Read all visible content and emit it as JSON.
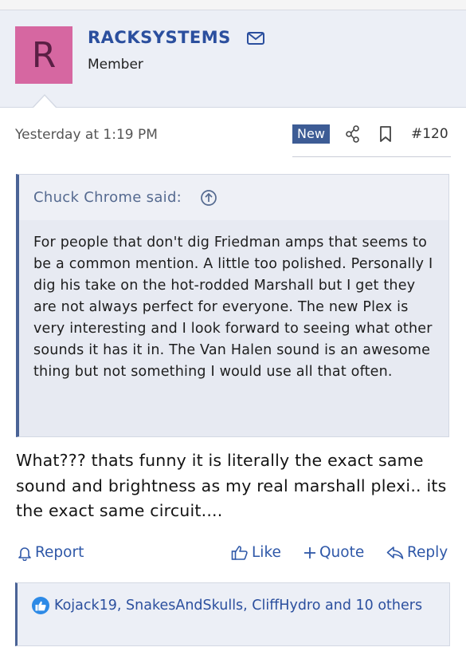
{
  "user": {
    "avatar_letter": "R",
    "avatar_color": "#d667a1",
    "name": "RACKSYSTEMS",
    "title": "Member"
  },
  "post": {
    "timestamp": "Yesterday at 1:19 PM",
    "badge": "New",
    "number": "#120",
    "quote": {
      "author_line": "Chuck Chrome said:",
      "text": "For people that don't dig Friedman amps that seems to be a common mention. A little too polished. Personally I dig his take on the hot-rodded Marshall but I get they are not always perfect for everyone. The new Plex is very interesting and I look forward to seeing what other sounds it has it in. The Van Halen sound is an awesome thing but not something I would use all that often."
    },
    "body": "What??? thats funny it is literally the exact same sound and brightness as my real marshall plexi.. its the exact same circuit...."
  },
  "actions": {
    "report": "Report",
    "like": "Like",
    "quote": "Quote",
    "reply": "Reply"
  },
  "reactions": {
    "text": "Kojack19, SnakesAndSkulls, CliffHydro and 10 others"
  },
  "icons": [
    "mail-icon",
    "share-icon",
    "bookmark-icon",
    "arrow-up-circle-icon",
    "bell-icon",
    "thumbs-up-icon",
    "plus-icon",
    "reply-arrow-icon",
    "like-reaction-icon"
  ],
  "colors": {
    "accent": "#2b4f9e",
    "link": "#2f58a8",
    "badge": "#3d5c95",
    "quote_border": "#4a6396",
    "panel": "#eceff6"
  }
}
